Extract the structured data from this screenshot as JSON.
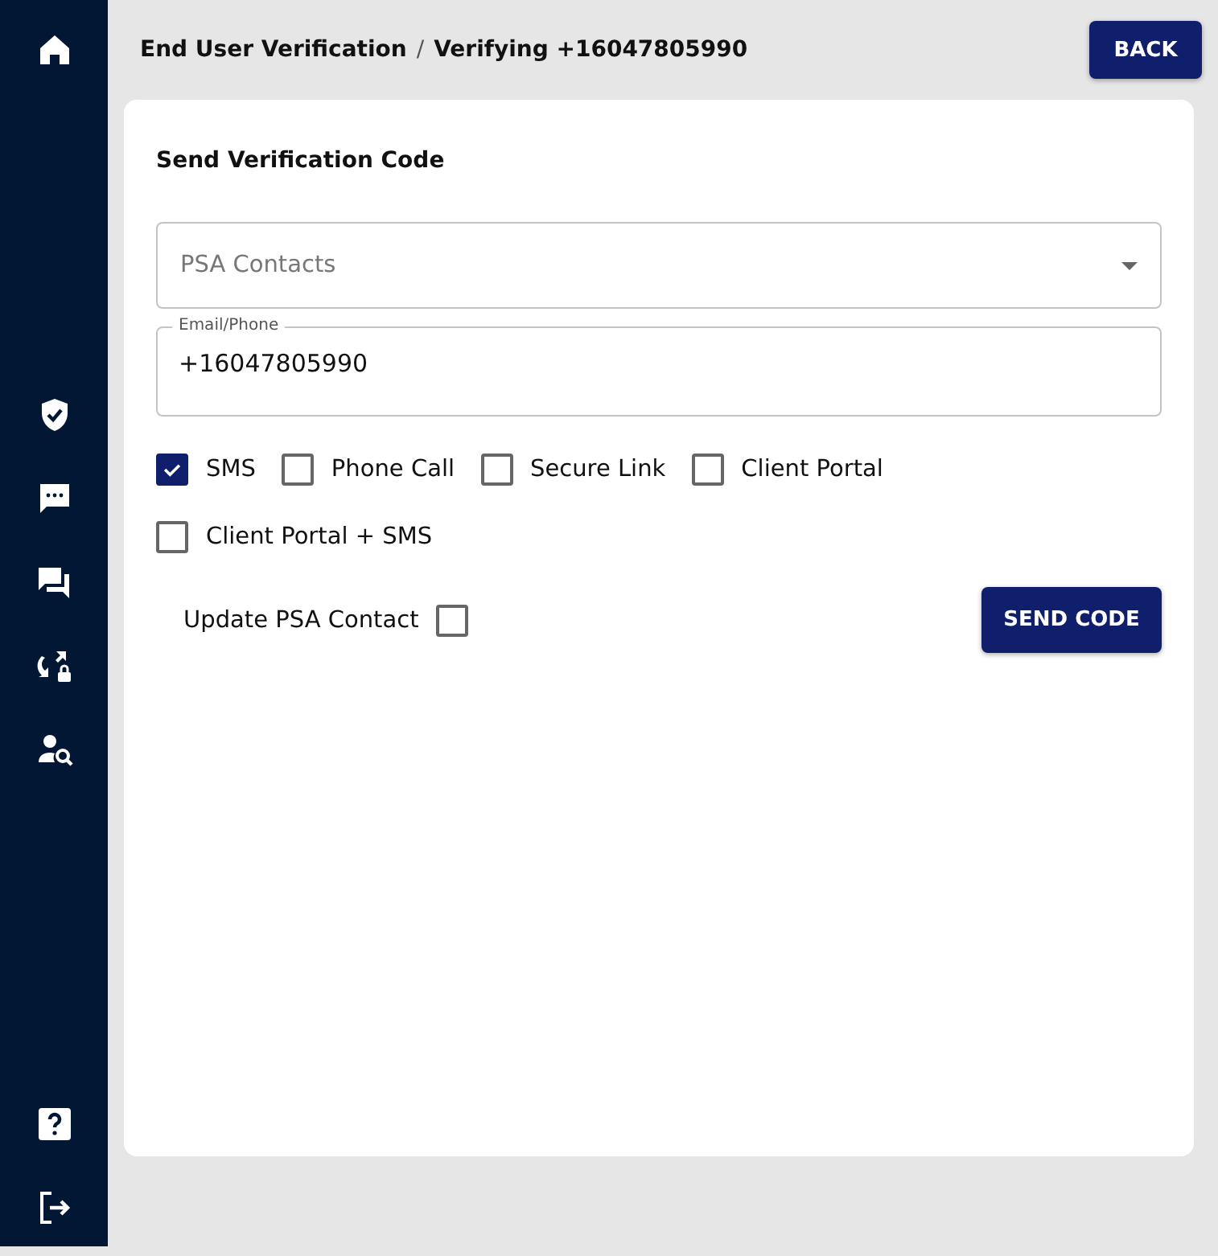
{
  "breadcrumb": {
    "parent": "End User Verification",
    "separator": "/",
    "current": "Verifying +16047805990"
  },
  "back_button": "BACK",
  "card": {
    "title": "Send Verification Code",
    "contact_select": {
      "placeholder": "PSA Contacts"
    },
    "email_phone": {
      "label": "Email/Phone",
      "value": "+16047805990"
    },
    "methods": [
      {
        "label": "SMS",
        "checked": true
      },
      {
        "label": "Phone Call",
        "checked": false
      },
      {
        "label": "Secure Link",
        "checked": false
      },
      {
        "label": "Client Portal",
        "checked": false
      },
      {
        "label": "Client Portal + SMS",
        "checked": false
      }
    ],
    "update_psa_contact": {
      "label": "Update PSA Contact",
      "checked": false
    },
    "send_button": "SEND CODE"
  }
}
